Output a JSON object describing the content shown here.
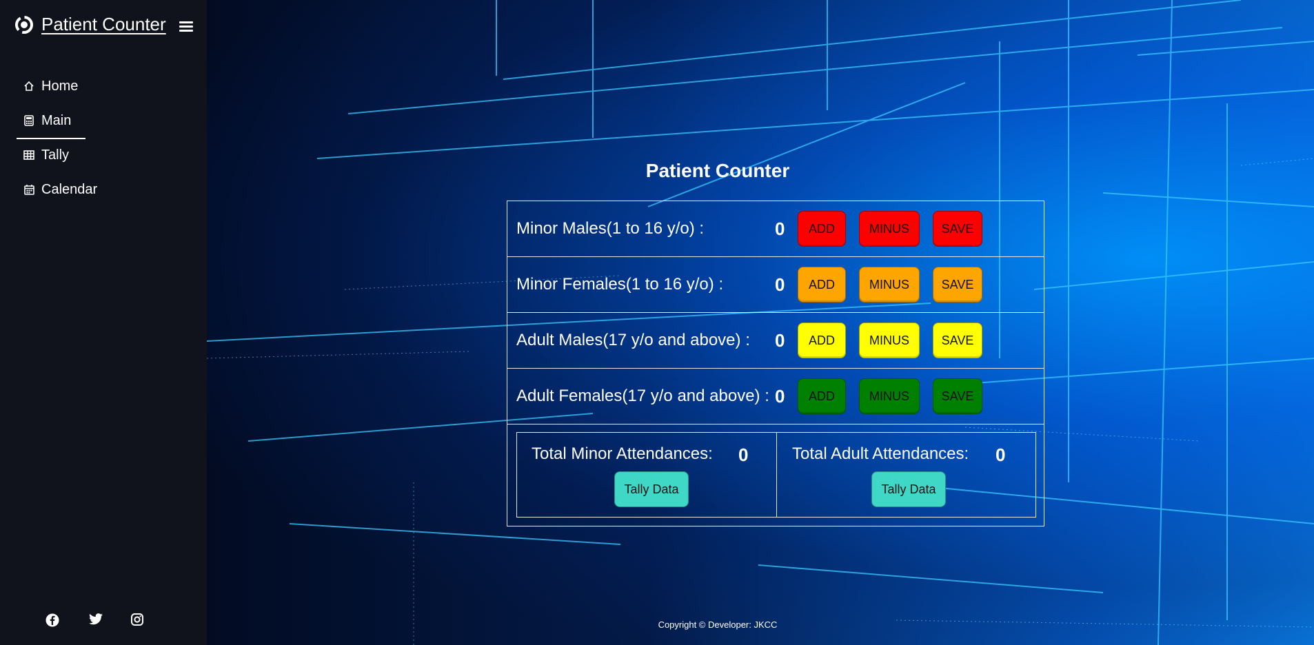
{
  "app": {
    "title": "Patient Counter"
  },
  "sidebar": {
    "items": [
      {
        "label": "Home",
        "icon": "home-icon"
      },
      {
        "label": "Main",
        "icon": "calculator-icon",
        "active": true
      },
      {
        "label": "Tally",
        "icon": "table-icon"
      },
      {
        "label": "Calendar",
        "icon": "calendar-icon"
      }
    ],
    "socials": [
      "facebook-icon",
      "twitter-icon",
      "instagram-icon"
    ]
  },
  "main": {
    "title": "Patient Counter",
    "rows": [
      {
        "label": "Minor Males(1 to 16 y/o) :",
        "count": "0",
        "color": "#ff0000",
        "add": "ADD",
        "minus": "MINUS",
        "save": "SAVE"
      },
      {
        "label": "Minor Females(1 to 16 y/o) :",
        "count": "0",
        "color": "#ffa500",
        "add": "ADD",
        "minus": "MINUS",
        "save": "SAVE"
      },
      {
        "label": "Adult Males(17 y/o and above) :",
        "count": "0",
        "color": "#ffff00",
        "add": "ADD",
        "minus": "MINUS",
        "save": "SAVE"
      },
      {
        "label": "Adult Females(17 y/o and above) :",
        "count": "0",
        "color": "#008000",
        "add": "ADD",
        "minus": "MINUS",
        "save": "SAVE"
      }
    ],
    "totals": {
      "minor_label": "Total Minor Attendances:",
      "minor_value": "0",
      "adult_label": "Total Adult Attendances:",
      "adult_value": "0",
      "tally_button": "Tally Data",
      "tally_color": "#3fd8c6"
    }
  },
  "footer": {
    "copyright": "Copyright © Developer: JKCC"
  }
}
